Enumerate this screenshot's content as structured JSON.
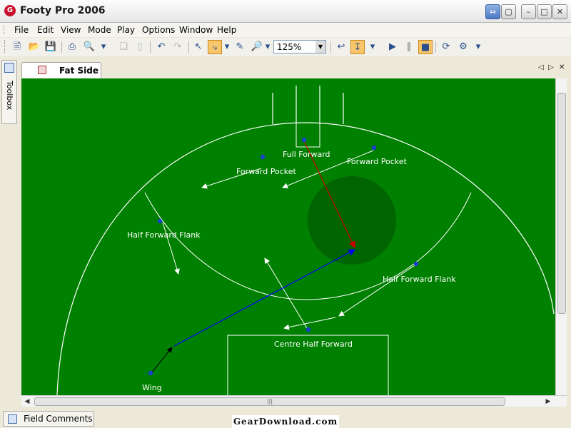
{
  "window": {
    "app_icon_letter": "G",
    "title": "Footy Pro 2006"
  },
  "menu": [
    "File",
    "Edit",
    "View",
    "Mode",
    "Play",
    "Options",
    "Window",
    "Help"
  ],
  "toolbar": {
    "zoom": "125%"
  },
  "toolbox": {
    "label": "Toolbox"
  },
  "doc_tab": {
    "label": "Fat Side"
  },
  "field": {
    "positions": [
      {
        "label": "Full Forward"
      },
      {
        "label": "Forward Pocket"
      },
      {
        "label": "Forward Pocket"
      },
      {
        "label": "Half Forward Flank"
      },
      {
        "label": "Half Forward Flank"
      },
      {
        "label": "Centre Half Forward"
      },
      {
        "label": "Wing"
      }
    ],
    "colors": {
      "grass": "#008000",
      "zone": "#006400",
      "kick_path": "#0000ff",
      "lead_path": "#cc0000",
      "player": "#1a3fd0"
    }
  },
  "bottom": {
    "field_comments": "Field Comments"
  },
  "watermark": "GearDownload.com"
}
